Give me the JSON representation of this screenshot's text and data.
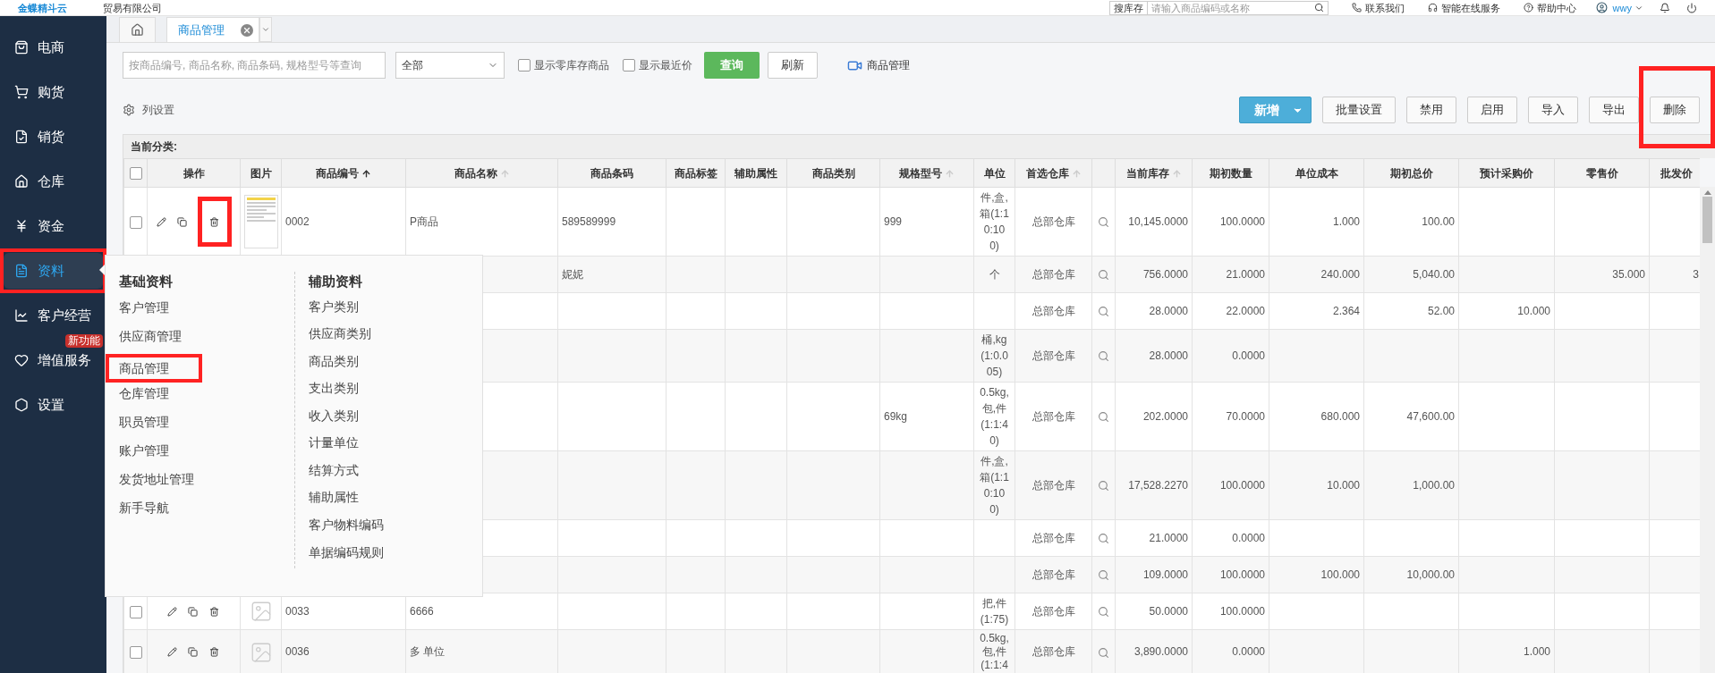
{
  "header": {
    "logo": "金蝶精斗云",
    "company": "贸易有限公司",
    "search_scope": "搜库存",
    "search_placeholder": "请输入商品编码或名称",
    "links": [
      "联系我们",
      "智能在线服务",
      "帮助中心"
    ],
    "user": "wwy"
  },
  "sidebar": {
    "items": [
      {
        "label": "电商",
        "selected": false,
        "highlighted": false
      },
      {
        "label": "购货",
        "selected": false,
        "highlighted": false
      },
      {
        "label": "销货",
        "selected": false,
        "highlighted": false
      },
      {
        "label": "仓库",
        "selected": false,
        "highlighted": false
      },
      {
        "label": "资金",
        "selected": false,
        "highlighted": false
      },
      {
        "label": "资料",
        "selected": true,
        "highlighted": true
      },
      {
        "label": "客户经营",
        "selected": false,
        "highlighted": false
      },
      {
        "label": "增值服务",
        "selected": false,
        "highlighted": false,
        "badge": "新功能"
      },
      {
        "label": "设置",
        "selected": false,
        "highlighted": false
      }
    ]
  },
  "tabs": [
    {
      "kind": "home",
      "selected": false
    },
    {
      "kind": "page",
      "label": "商品管理",
      "selected": true
    }
  ],
  "filter": {
    "search_placeholder": "按商品编号, 商品名称, 商品条码, 规格型号等查询",
    "category": "全部",
    "checkboxes": [
      {
        "label": "显示零库存商品",
        "checked": false
      },
      {
        "label": "显示最近价",
        "checked": false
      }
    ],
    "query_button": "查询",
    "refresh_button": "刷新",
    "video_link": "商品管理"
  },
  "toolbar": {
    "column_settings": "列设置",
    "buttons": [
      {
        "label": "新增",
        "kind": "primary",
        "highlighted": false
      },
      {
        "label": "批量设置",
        "kind": "plain",
        "highlighted": false
      },
      {
        "label": "禁用",
        "kind": "plain",
        "highlighted": false
      },
      {
        "label": "启用",
        "kind": "plain",
        "highlighted": false
      },
      {
        "label": "导入",
        "kind": "plain",
        "highlighted": false
      },
      {
        "label": "导出",
        "kind": "plain",
        "highlighted": false
      },
      {
        "label": "删除",
        "kind": "plain",
        "highlighted": true
      }
    ]
  },
  "category_label": "当前分类:",
  "table": {
    "select_all": {
      "checked": false
    },
    "columns": [
      {
        "kind": "actions",
        "label": "操作"
      },
      {
        "kind": "image",
        "label": "图片"
      },
      {
        "kind": "text",
        "label": "商品编号",
        "sort_active": true
      },
      {
        "kind": "text",
        "label": "商品名称",
        "sort_active": false
      },
      {
        "kind": "text",
        "label": "商品条码"
      },
      {
        "kind": "text",
        "label": "商品标签"
      },
      {
        "kind": "text",
        "label": "辅助属性"
      },
      {
        "kind": "text",
        "label": "商品类别"
      },
      {
        "kind": "text",
        "label": "规格型号",
        "sort_active": false
      },
      {
        "kind": "text",
        "label": "单位"
      },
      {
        "kind": "text",
        "label": "首选仓库",
        "sort_active": false
      },
      {
        "kind": "lookup"
      },
      {
        "kind": "text",
        "label": "当前库存",
        "sort_active": false
      },
      {
        "kind": "text",
        "label": "期初数量"
      },
      {
        "kind": "text",
        "label": "单位成本"
      },
      {
        "kind": "text",
        "label": "期初总价"
      },
      {
        "kind": "text",
        "label": "预计采购价"
      },
      {
        "kind": "text",
        "label": "零售价"
      },
      {
        "kind": "text",
        "label": "批发价"
      }
    ],
    "rows": [
      {
        "checked": false,
        "actions": {
          "trash_highlighted": true
        },
        "image": {
          "kind": "thumbnail"
        },
        "cells": [
          "",
          "",
          "0002",
          "P商品",
          "589589999",
          "",
          "",
          "",
          "999",
          "件,盒,箱(1:10:100)",
          "总部仓库",
          "",
          "10,145.0000",
          "100.0000",
          "1.000",
          "100.00",
          "",
          "",
          ""
        ]
      },
      {
        "cells": [
          "",
          "",
          "",
          "",
          "妮妮",
          "",
          "",
          "",
          "",
          "个",
          "总部仓库",
          "",
          "756.0000",
          "21.0000",
          "240.000",
          "5,040.00",
          "",
          "35.000",
          "3"
        ]
      },
      {
        "cells": [
          "",
          "",
          "",
          "",
          "",
          "",
          "",
          "",
          "",
          "",
          "总部仓库",
          "",
          "28.0000",
          "22.0000",
          "2.364",
          "52.00",
          "10.000",
          "",
          ""
        ]
      },
      {
        "cells": [
          "",
          "",
          "",
          "",
          "",
          "",
          "",
          "",
          "",
          "桶,kg(1:0.005)",
          "总部仓库",
          "",
          "28.0000",
          "0.0000",
          "",
          "",
          "",
          "",
          ""
        ]
      },
      {
        "cells": [
          "",
          "",
          "",
          "",
          "",
          "",
          "",
          "",
          "69kg",
          "0.5kg,包,件(1:1:40)",
          "总部仓库",
          "",
          "202.0000",
          "70.0000",
          "680.000",
          "47,600.00",
          "",
          "",
          ""
        ]
      },
      {
        "cells": [
          "",
          "",
          "",
          "",
          "",
          "",
          "",
          "",
          "",
          "件,盒,箱(1:10:100)",
          "总部仓库",
          "",
          "17,528.2270",
          "100.0000",
          "10.000",
          "1,000.00",
          "",
          "",
          ""
        ]
      },
      {
        "cells": [
          "",
          "",
          "",
          "",
          "",
          "",
          "",
          "",
          "",
          "",
          "总部仓库",
          "",
          "21.0000",
          "0.0000",
          "",
          "",
          "",
          "",
          ""
        ]
      },
      {
        "cells": [
          "",
          "",
          "",
          "",
          "",
          "",
          "",
          "",
          "",
          "",
          "总部仓库",
          "",
          "109.0000",
          "100.0000",
          "100.000",
          "10,000.00",
          "",
          "",
          ""
        ]
      },
      {
        "checked": false,
        "actions": {
          "trash_highlighted": false
        },
        "image": {
          "kind": "placeholder"
        },
        "cells": [
          "",
          "",
          "0033",
          "6666",
          "",
          "",
          "",
          "",
          "",
          "把,件(1:75)",
          "总部仓库",
          "",
          "50.0000",
          "100.0000",
          "",
          "",
          "",
          "",
          ""
        ]
      },
      {
        "checked": false,
        "actions": {
          "trash_highlighted": false
        },
        "image": {
          "kind": "placeholder"
        },
        "cells": [
          "",
          "",
          "0036",
          "多 单位",
          "",
          "",
          "",
          "",
          "",
          "0.5kg,包,件(1:1:4",
          "总部仓库",
          "",
          "3,890.0000",
          "0.0000",
          "",
          "",
          "1.000",
          "",
          ""
        ]
      }
    ]
  },
  "popup_menu": {
    "columns": [
      {
        "heading": "基础资料",
        "items": [
          {
            "label": "客户管理",
            "highlighted": false
          },
          {
            "label": "供应商管理",
            "highlighted": false
          },
          {
            "label": "商品管理",
            "highlighted": true
          },
          {
            "label": "仓库管理",
            "highlighted": false
          },
          {
            "label": "职员管理",
            "highlighted": false
          },
          {
            "label": "账户管理",
            "highlighted": false
          },
          {
            "label": "发货地址管理",
            "highlighted": false
          },
          {
            "label": "新手导航",
            "highlighted": false
          }
        ]
      },
      {
        "heading": "辅助资料",
        "items": [
          {
            "label": "客户类别",
            "highlighted": false
          },
          {
            "label": "供应商类别",
            "highlighted": false
          },
          {
            "label": "商品类别",
            "highlighted": false
          },
          {
            "label": "支出类别",
            "highlighted": false
          },
          {
            "label": "收入类别",
            "highlighted": false
          },
          {
            "label": "计量单位",
            "highlighted": false
          },
          {
            "label": "结算方式",
            "highlighted": false
          },
          {
            "label": "辅助属性",
            "highlighted": false
          },
          {
            "label": "客户物料编码",
            "highlighted": false
          },
          {
            "label": "单据编码规则",
            "highlighted": false
          }
        ]
      }
    ]
  }
}
